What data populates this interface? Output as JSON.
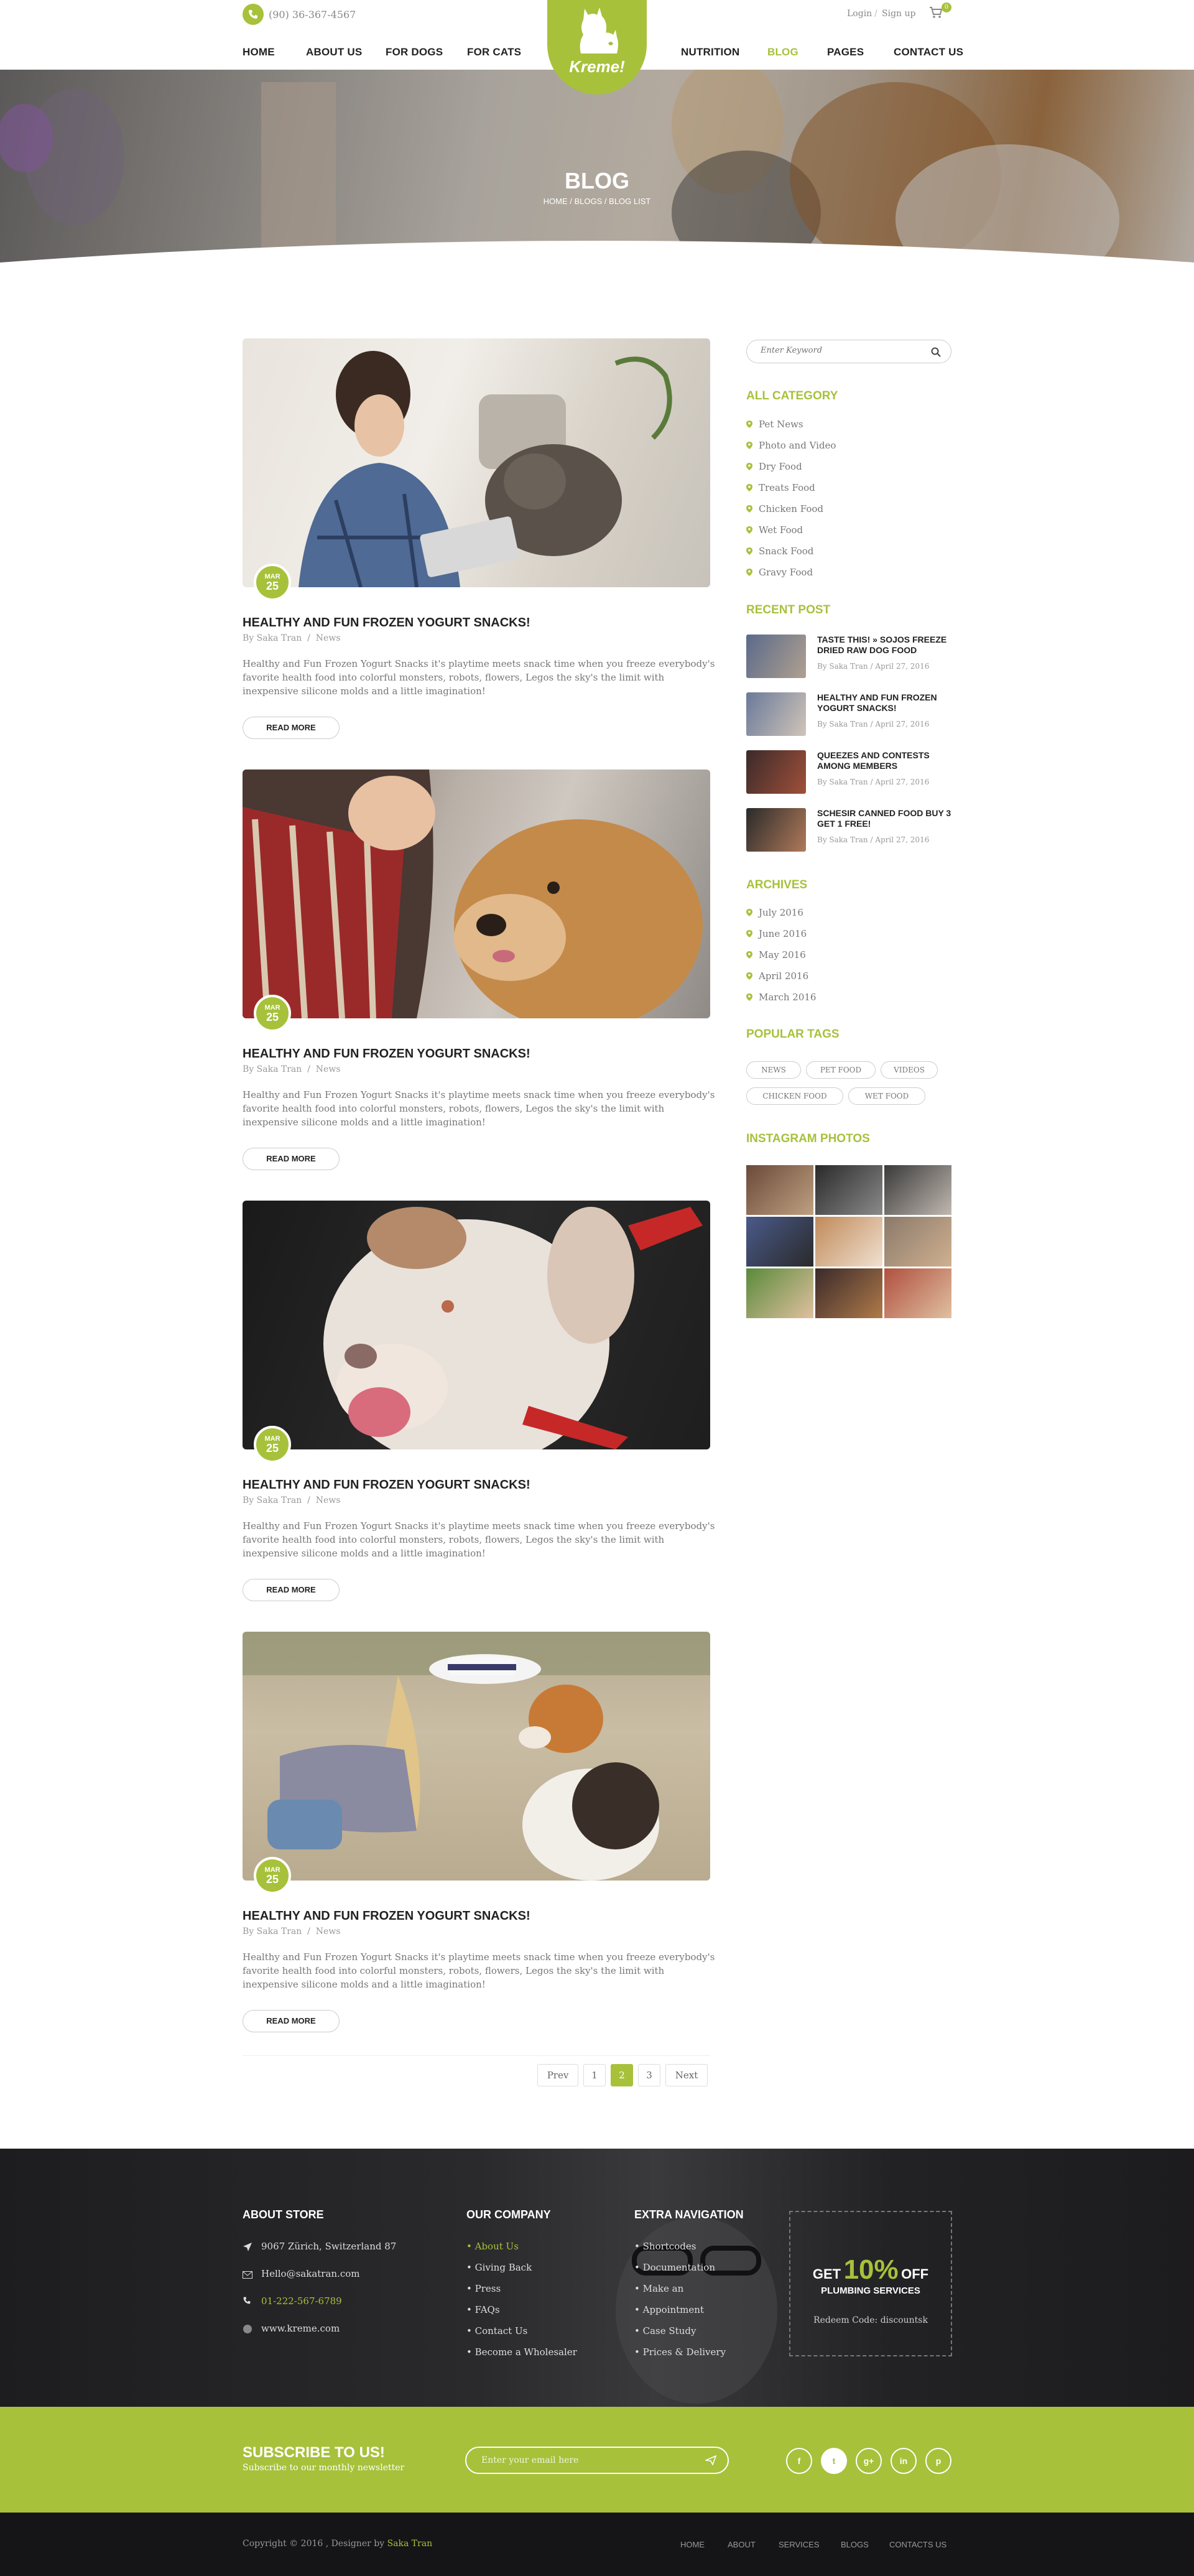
{
  "header": {
    "phone": "(90) 36-367-4567",
    "login": "Login",
    "signup": "Sign up",
    "cart_count": "0",
    "logo": "Kreme!",
    "nav": [
      "HOME",
      "ABOUT US",
      "FOR DOGS",
      "FOR CATS",
      "NUTRITION",
      "BLOG",
      "PAGES",
      "CONTACT US"
    ],
    "active_nav": "BLOG"
  },
  "hero": {
    "title": "BLOG",
    "breadcrumb": [
      "HOME",
      "BLOGS",
      "BLOG LIST"
    ]
  },
  "posts": [
    {
      "month": "MAR",
      "day": "25",
      "title": "HEALTHY AND FUN FROZEN YOGURT SNACKS!",
      "author": "By Saka Tran",
      "category": "News",
      "excerpt": "Healthy and Fun Frozen Yogurt Snacks it's playtime meets snack time when you freeze everybody's favorite health food into colorful monsters, robots, flowers, Legos the sky's the limit with inexpensive silicone molds and a little imagination!",
      "read_more": "READ MORE"
    },
    {
      "month": "MAR",
      "day": "25",
      "title": "HEALTHY AND FUN FROZEN YOGURT SNACKS!",
      "author": "By Saka Tran",
      "category": "News",
      "excerpt": "Healthy and Fun Frozen Yogurt Snacks it's playtime meets snack time when you freeze everybody's favorite health food into colorful monsters, robots, flowers, Legos the sky's the limit with inexpensive silicone molds and a little imagination!",
      "read_more": "READ MORE"
    },
    {
      "month": "MAR",
      "day": "25",
      "title": "HEALTHY AND FUN FROZEN YOGURT SNACKS!",
      "author": "By Saka Tran",
      "category": "News",
      "excerpt": "Healthy and Fun Frozen Yogurt Snacks it's playtime meets snack time when you freeze everybody's favorite health food into colorful monsters, robots, flowers, Legos the sky's the limit with inexpensive silicone molds and a little imagination!",
      "read_more": "READ MORE"
    },
    {
      "month": "MAR",
      "day": "25",
      "title": "HEALTHY AND FUN FROZEN YOGURT SNACKS!",
      "author": "By Saka Tran",
      "category": "News",
      "excerpt": "Healthy and Fun Frozen Yogurt Snacks it's playtime meets snack time when you freeze everybody's favorite health food into colorful monsters, robots, flowers, Legos the sky's the limit with inexpensive silicone molds and a little imagination!",
      "read_more": "READ MORE"
    }
  ],
  "pagination": {
    "prev": "Prev",
    "pages": [
      "1",
      "2",
      "3"
    ],
    "current": "2",
    "next": "Next"
  },
  "sidebar": {
    "search_placeholder": "Enter Keyword",
    "category_title": "ALL CATEGORY",
    "categories": [
      "Pet News",
      "Photo and Video",
      "Dry Food",
      "Treats Food",
      "Chicken Food",
      "Wet Food",
      "Snack Food",
      "Gravy Food"
    ],
    "recent_title": "RECENT POST",
    "recent": [
      {
        "title": "TASTE THIS! » SOJOS FREEZE DRIED RAW DOG FOOD",
        "meta": "By Saka Tran / April 27, 2016"
      },
      {
        "title": "HEALTHY AND FUN FROZEN YOGURT SNACKS!",
        "meta": "By Saka Tran / April 27, 2016"
      },
      {
        "title": "QUEEZES AND CONTESTS AMONG MEMBERS",
        "meta": "By Saka Tran / April 27, 2016"
      },
      {
        "title": "SCHESIR CANNED FOOD BUY 3 GET 1 FREE!",
        "meta": "By Saka Tran / April 27, 2016"
      }
    ],
    "archives_title": "ARCHIVES",
    "archives": [
      "July 2016",
      "June 2016",
      "May 2016",
      "April 2016",
      "March 2016"
    ],
    "tags_title": "POPULAR TAGS",
    "tags": [
      "NEWS",
      "PET FOOD",
      "VIDEOS",
      "CHICKEN FOOD",
      "WET FOOD"
    ],
    "instagram_title": "INSTAGRAM PHOTOS"
  },
  "footer": {
    "about_title": "ABOUT STORE",
    "address": "9067 Zürich, Switzerland 87",
    "email": "Hello@sakatran.com",
    "phone": "01-222-567-6789",
    "website": "www.kreme.com",
    "company_title": "OUR COMPANY",
    "company": [
      "About Us",
      "Giving Back",
      "Press",
      "FAQs",
      "Contact Us",
      "Become a Wholesaler"
    ],
    "extra_title": "EXTRA NAVIGATION",
    "extra": [
      "Shortcodes",
      "Documentation",
      "Make an",
      "Appointment",
      "Case Study",
      "Prices & Delivery"
    ],
    "promo_get": "GET",
    "promo_percent": "10%",
    "promo_off": "OFF",
    "promo_service": "PLUMBING SERVICES",
    "promo_code": "Redeem Code: discountsk"
  },
  "subscribe": {
    "title": "SUBSCRIBE TO US!",
    "subtitle": "Subscribe to our monthly newsletter",
    "placeholder": "Enter your email here",
    "social": [
      "f",
      "t",
      "g+",
      "in",
      "p"
    ]
  },
  "bottom": {
    "copyright": "Copyright © 2016 , Designer by",
    "designer": "Saka Tran",
    "nav": [
      "HOME",
      "ABOUT",
      "SERVICES",
      "BLOGS",
      "CONTACTS US"
    ]
  },
  "colors": {
    "accent": "#a7c13b",
    "dark": "#1d1d1f",
    "text": "#555555"
  }
}
